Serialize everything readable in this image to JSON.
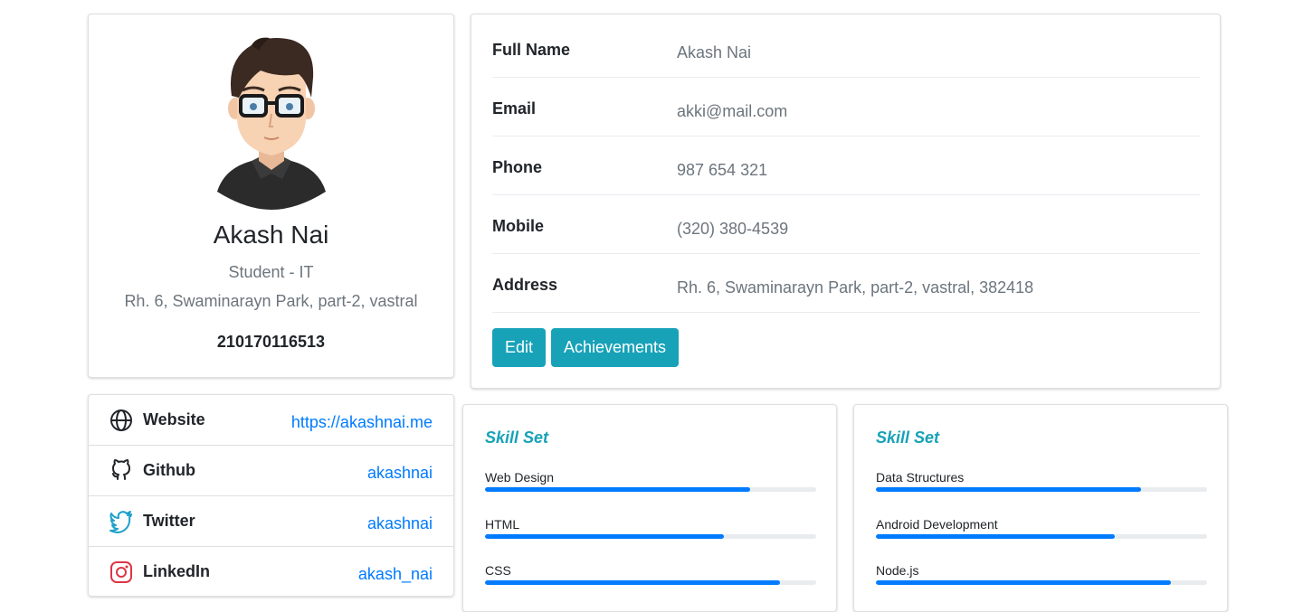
{
  "profile": {
    "name": "Akash Nai",
    "role": "Student - IT",
    "address": "Rh. 6, Swaminarayn Park, part-2, vastral",
    "id": "210170116513",
    "avatar": "cartoon-avatar"
  },
  "details": {
    "rows": [
      {
        "label": "Full Name",
        "value": "Akash Nai"
      },
      {
        "label": "Email",
        "value": "akki@mail.com"
      },
      {
        "label": "Phone",
        "value": "987 654 321"
      },
      {
        "label": "Mobile",
        "value": "(320) 380-4539"
      },
      {
        "label": "Address",
        "value": "Rh. 6, Swaminarayn Park, part-2, vastral, 382418"
      }
    ],
    "edit_label": "Edit",
    "achievements_label": "Achievements"
  },
  "social": [
    {
      "label": "Website",
      "value": "https://akashnai.me",
      "icon": "globe-icon"
    },
    {
      "label": "Github",
      "value": "akashnai",
      "icon": "github-icon"
    },
    {
      "label": "Twitter",
      "value": "akashnai",
      "icon": "twitter-icon"
    },
    {
      "label": "LinkedIn",
      "value": "akash_nai",
      "icon": "instagram-icon"
    }
  ],
  "skills": [
    {
      "title": "Skill Set",
      "items": [
        {
          "name": "Web Design",
          "level": 0.8
        },
        {
          "name": "HTML",
          "level": 0.72
        },
        {
          "name": "CSS",
          "level": 0.89
        }
      ]
    },
    {
      "title": "Skill Set",
      "items": [
        {
          "name": "Data Structures",
          "level": 0.8
        },
        {
          "name": "Android Development",
          "level": 0.72
        },
        {
          "name": "Node.js",
          "level": 0.89
        }
      ]
    }
  ],
  "colors": {
    "accent": "#17a2b8",
    "link": "#007bff",
    "progress": "#007bff",
    "muted": "#6c757d"
  }
}
